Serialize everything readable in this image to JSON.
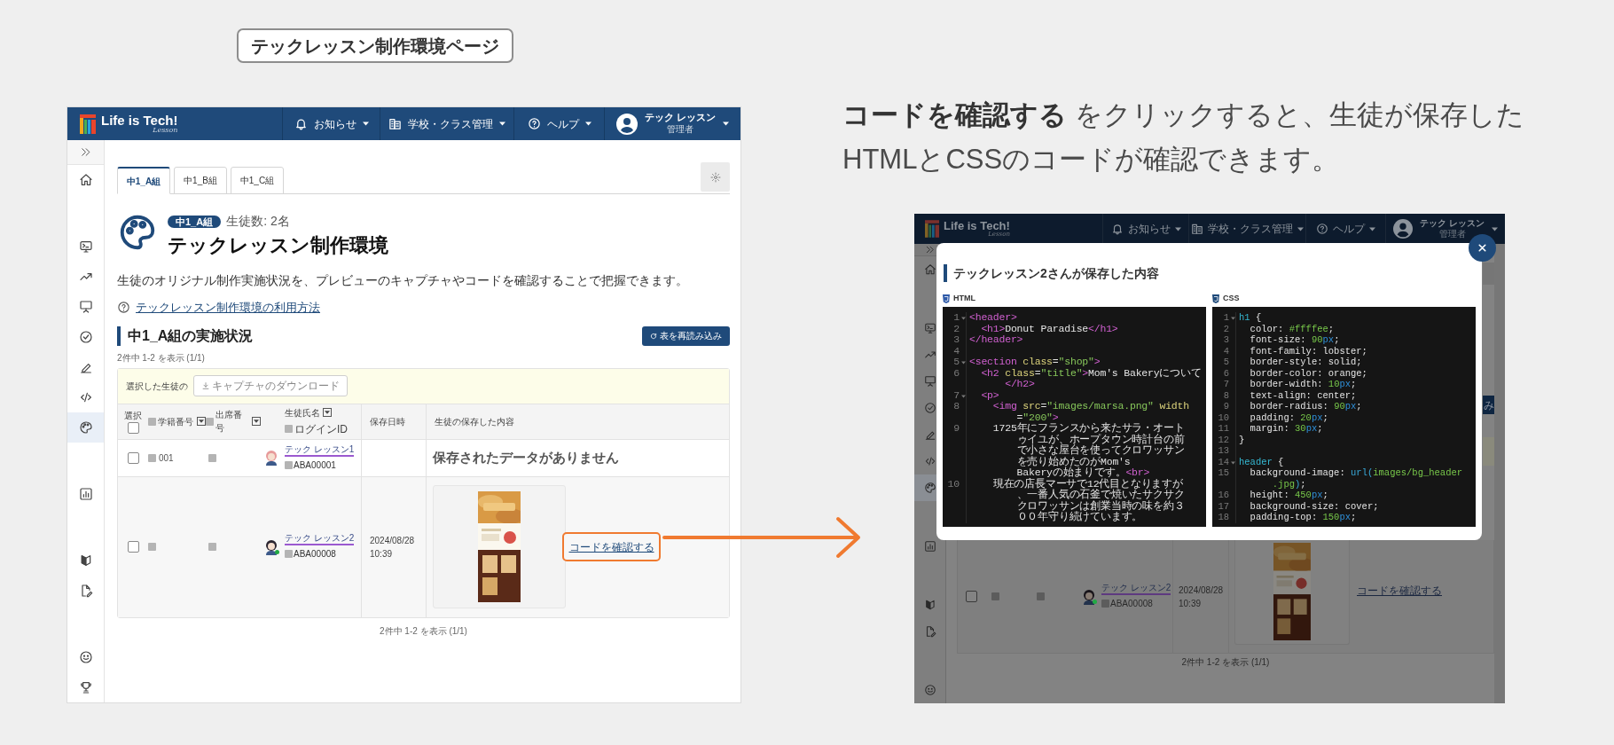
{
  "page_heading": "テックレッスン制作環境ページ",
  "caption": [
    "**コードを確認する** をクリックすると、生徒が保存した",
    "HTMLとCSSのコードが確認できます。"
  ],
  "main_screen": {
    "navbar": {
      "logo": "Life is Tech!",
      "logo_sub": "Lesson",
      "menus": [
        {
          "kind": "bell",
          "label": "お知らせ"
        },
        {
          "kind": "building",
          "label": "学校・クラス管理"
        },
        {
          "kind": "help",
          "label": "ヘルプ"
        }
      ],
      "user": {
        "name": "テック レッスン",
        "role": "管理者"
      }
    },
    "sidebar": {
      "groups": [
        [
          {
            "kind": "home",
            "selected": false
          }
        ],
        [
          {
            "kind": "terminal",
            "selected": false
          },
          {
            "kind": "trend",
            "selected": false
          },
          {
            "kind": "presentation",
            "selected": false
          },
          {
            "kind": "check",
            "selected": false
          },
          {
            "kind": "pencil",
            "selected": false
          },
          {
            "kind": "code",
            "selected": false
          },
          {
            "kind": "palette",
            "selected": true
          }
        ],
        [
          {
            "kind": "chart",
            "selected": false
          }
        ],
        [
          {
            "kind": "book",
            "selected": false
          },
          {
            "kind": "doc",
            "selected": false
          }
        ],
        [
          {
            "kind": "smile",
            "selected": false
          },
          {
            "kind": "trophy",
            "selected": false
          }
        ]
      ]
    },
    "tabs": [
      {
        "label": "中1_A組",
        "selected": true
      },
      {
        "label": "中1_B組",
        "selected": false
      },
      {
        "label": "中1_C組",
        "selected": false
      }
    ],
    "class_badge": "中1_A組",
    "student_count": "生徒数: 2名",
    "title": "テックレッスン制作環境",
    "description": "生徒のオリジナル制作実施状況を、プレビューのキャプチャやコードを確認することで把握できます。",
    "help_link": "テックレッスン制作環境の利用方法",
    "section_title": "中1_A組の実施状況",
    "reload_button": "表を再読み込み",
    "count_top": "2件中 1-2 を表示 (1/1)",
    "bulk_bar": {
      "label": "選択した生徒の",
      "button": "キャプチャのダウンロード",
      "disabled": true
    },
    "table": {
      "columns": [
        {
          "label": "選択",
          "kind": "select",
          "checked": false
        },
        {
          "label": "学籍番号",
          "kind": "sort"
        },
        {
          "label": "出席番号",
          "kind": "sort"
        },
        {
          "label": "生徒氏名",
          "sub": "ログインID",
          "kind": "name"
        },
        {
          "label": "保存日時",
          "kind": "plain"
        },
        {
          "label": "生徒の保存した内容",
          "kind": "plain"
        }
      ],
      "rows": [
        {
          "kind": "empty",
          "checked": false,
          "student_no": "001",
          "name": "テック レッスン1",
          "login_id": "ABA00001",
          "online": false,
          "message": "保存されたデータがありません"
        },
        {
          "kind": "saved",
          "checked": false,
          "name": "テック レッスン2",
          "login_id": "ABA00008",
          "online": true,
          "saved_date": "2024/08/28",
          "saved_time": "10:39",
          "code_link": "コードを確認する",
          "highlighted": true
        }
      ]
    },
    "count_bottom": "2件中 1-2 を表示 (1/1)"
  },
  "preview_screen": {
    "navbar": {
      "logo": "Life is Tech!",
      "logo_sub": "Lesson",
      "menus": [
        {
          "kind": "bell",
          "label": "お知らせ"
        },
        {
          "kind": "building",
          "label": "学校・クラス管理"
        },
        {
          "kind": "help",
          "label": "ヘルプ"
        }
      ],
      "user": {
        "name": "テック レッスン",
        "role": "管理者"
      }
    },
    "sidebar": {
      "groups": [
        [
          {
            "kind": "home",
            "selected": false
          }
        ],
        [
          {
            "kind": "terminal",
            "selected": false
          },
          {
            "kind": "trend",
            "selected": false
          },
          {
            "kind": "presentation",
            "selected": false
          },
          {
            "kind": "check",
            "selected": false
          },
          {
            "kind": "pencil",
            "selected": false
          },
          {
            "kind": "code",
            "selected": false
          },
          {
            "kind": "palette",
            "selected": true
          }
        ],
        [
          {
            "kind": "chart",
            "selected": false
          }
        ],
        [
          {
            "kind": "book",
            "selected": false
          },
          {
            "kind": "doc",
            "selected": false
          }
        ],
        [
          {
            "kind": "smile",
            "selected": false
          }
        ]
      ]
    },
    "reload_fragment": "み",
    "row": {
      "checked": false,
      "name": "テック レッスン2",
      "login_id": "ABA00008",
      "online": true,
      "saved_date": "2024/08/28",
      "saved_time": "10:39",
      "code_link": "コードを確認する"
    },
    "count_bottom": "2件中 1-2 を表示 (1/1)",
    "modal": {
      "title": "テックレッスン2さんが保存した内容",
      "panels": [
        {
          "label": "HTML",
          "kind": "html",
          "lines": [
            {
              "number": "1",
              "fold": true,
              "tokens": [
                {
                  "kind": "tag",
                  "text": "<header>"
                }
              ]
            },
            {
              "number": "2",
              "fold": false,
              "tokens": [
                {
                  "kind": "tag",
                  "text": "  <h1>"
                },
                {
                  "kind": "text",
                  "text": "Donut Paradise"
                },
                {
                  "kind": "tag",
                  "text": "</h1>"
                }
              ]
            },
            {
              "number": "3",
              "fold": false,
              "tokens": [
                {
                  "kind": "tag",
                  "text": "</header>"
                }
              ]
            },
            {
              "number": "4",
              "fold": false
            },
            {
              "number": "5",
              "fold": true,
              "tokens": [
                {
                  "kind": "tag",
                  "text": "<section"
                },
                {
                  "kind": "attr",
                  "text": " class"
                },
                {
                  "kind": "text",
                  "text": "="
                },
                {
                  "kind": "str",
                  "text": "\"shop\""
                },
                {
                  "kind": "tag",
                  "text": ">"
                }
              ]
            },
            {
              "number": "6",
              "fold": false,
              "tokens": [
                {
                  "kind": "tag",
                  "text": "  <h2"
                },
                {
                  "kind": "attr",
                  "text": " class"
                },
                {
                  "kind": "text",
                  "text": "="
                },
                {
                  "kind": "str",
                  "text": "\"title\""
                },
                {
                  "kind": "tag",
                  "text": ">"
                },
                {
                  "kind": "text",
                  "text": "Mom's Bakeryについて"
                }
              ]
            },
            {
              "tokens": [
                {
                  "kind": "tag",
                  "text": "      </h2>"
                }
              ]
            },
            {
              "number": "7",
              "fold": true,
              "tokens": [
                {
                  "kind": "tag",
                  "text": "  <p>"
                }
              ]
            },
            {
              "number": "8",
              "fold": false,
              "tokens": [
                {
                  "kind": "tag",
                  "text": "    <img"
                },
                {
                  "kind": "attr",
                  "text": " src"
                },
                {
                  "kind": "text",
                  "text": "="
                },
                {
                  "kind": "str",
                  "text": "\"images/marsa.png\""
                },
                {
                  "kind": "attr",
                  "text": " width"
                }
              ]
            },
            {
              "tokens": [
                {
                  "kind": "text",
                  "text": "        ="
                },
                {
                  "kind": "str",
                  "text": "\"200\""
                },
                {
                  "kind": "tag",
                  "text": ">"
                }
              ]
            },
            {
              "number": "9",
              "fold": false,
              "tokens": [
                {
                  "kind": "text",
                  "text": "    1725年にフランスから来たサラ・オート"
                }
              ]
            },
            {
              "tokens": [
                {
                  "kind": "text",
                  "text": "        ゥイユが、ホープタウン時計台の前"
                }
              ]
            },
            {
              "tokens": [
                {
                  "kind": "text",
                  "text": "        で小さな屋台を使ってクロワッサン"
                }
              ]
            },
            {
              "tokens": [
                {
                  "kind": "text",
                  "text": "        を売り始めたのがMom's"
                }
              ]
            },
            {
              "tokens": [
                {
                  "kind": "text",
                  "text": "        Bakeryの始まりです。"
                },
                {
                  "kind": "tag",
                  "text": "<br>"
                }
              ]
            },
            {
              "number": "10",
              "fold": false,
              "tokens": [
                {
                  "kind": "text",
                  "text": "    現在の店長マーサで12代目となりますが"
                }
              ]
            },
            {
              "tokens": [
                {
                  "kind": "text",
                  "text": "        、一番人気の石釜で焼いたサクサク"
                }
              ]
            },
            {
              "tokens": [
                {
                  "kind": "text",
                  "text": "        クロワッサンは創業当時の味を約３"
                }
              ]
            },
            {
              "tokens": [
                {
                  "kind": "text",
                  "text": "        ００年守り続けています。"
                }
              ]
            }
          ]
        },
        {
          "label": "CSS",
          "kind": "css",
          "lines": [
            {
              "number": "1",
              "fold": true,
              "tokens": [
                {
                  "kind": "sel",
                  "text": "h1"
                },
                {
                  "kind": "text",
                  "text": " {"
                }
              ]
            },
            {
              "number": "2",
              "fold": false,
              "tokens": [
                {
                  "kind": "text",
                  "text": "  color: "
                },
                {
                  "kind": "num",
                  "text": "#ffffee"
                },
                {
                  "kind": "text",
                  "text": ";"
                }
              ]
            },
            {
              "number": "3",
              "fold": false,
              "tokens": [
                {
                  "kind": "text",
                  "text": "  font-size: "
                },
                {
                  "kind": "num",
                  "text": "90"
                },
                {
                  "kind": "unit",
                  "text": "px"
                },
                {
                  "kind": "text",
                  "text": ";"
                }
              ]
            },
            {
              "number": "4",
              "fold": false,
              "tokens": [
                {
                  "kind": "text",
                  "text": "  font-family: lobster;"
                }
              ]
            },
            {
              "number": "5",
              "fold": false,
              "tokens": [
                {
                  "kind": "text",
                  "text": "  border-style: solid;"
                }
              ]
            },
            {
              "number": "6",
              "fold": false,
              "tokens": [
                {
                  "kind": "text",
                  "text": "  border-color: orange;"
                }
              ]
            },
            {
              "number": "7",
              "fold": false,
              "tokens": [
                {
                  "kind": "text",
                  "text": "  border-width: "
                },
                {
                  "kind": "num",
                  "text": "10"
                },
                {
                  "kind": "unit",
                  "text": "px"
                },
                {
                  "kind": "text",
                  "text": ";"
                }
              ]
            },
            {
              "number": "8",
              "fold": false,
              "tokens": [
                {
                  "kind": "text",
                  "text": "  text-align: center;"
                }
              ]
            },
            {
              "number": "9",
              "fold": false,
              "tokens": [
                {
                  "kind": "text",
                  "text": "  border-radius: "
                },
                {
                  "kind": "num",
                  "text": "90"
                },
                {
                  "kind": "unit",
                  "text": "px"
                },
                {
                  "kind": "text",
                  "text": ";"
                }
              ]
            },
            {
              "number": "10",
              "fold": false,
              "tokens": [
                {
                  "kind": "text",
                  "text": "  padding: "
                },
                {
                  "kind": "num",
                  "text": "20"
                },
                {
                  "kind": "unit",
                  "text": "px"
                },
                {
                  "kind": "text",
                  "text": ";"
                }
              ]
            },
            {
              "number": "11",
              "fold": false,
              "tokens": [
                {
                  "kind": "text",
                  "text": "  margin: "
                },
                {
                  "kind": "num",
                  "text": "30"
                },
                {
                  "kind": "unit",
                  "text": "px"
                },
                {
                  "kind": "text",
                  "text": ";"
                }
              ]
            },
            {
              "number": "12",
              "fold": false,
              "tokens": [
                {
                  "kind": "text",
                  "text": "}"
                }
              ]
            },
            {
              "number": "13",
              "fold": false
            },
            {
              "number": "14",
              "fold": true,
              "tokens": [
                {
                  "kind": "sel",
                  "text": "header"
                },
                {
                  "kind": "text",
                  "text": " {"
                }
              ]
            },
            {
              "number": "15",
              "fold": false,
              "tokens": [
                {
                  "kind": "text",
                  "text": "  background-image: "
                },
                {
                  "kind": "url",
                  "text": "url("
                },
                {
                  "kind": "num",
                  "text": "images/bg_header"
                }
              ]
            },
            {
              "tokens": [
                {
                  "kind": "num",
                  "text": "      .jpg"
                },
                {
                  "kind": "url",
                  "text": ")"
                },
                {
                  "kind": "text",
                  "text": ";"
                }
              ]
            },
            {
              "number": "16",
              "fold": false,
              "tokens": [
                {
                  "kind": "text",
                  "text": "  height: "
                },
                {
                  "kind": "num",
                  "text": "450"
                },
                {
                  "kind": "unit",
                  "text": "px"
                },
                {
                  "kind": "text",
                  "text": ";"
                }
              ]
            },
            {
              "number": "17",
              "fold": false,
              "tokens": [
                {
                  "kind": "text",
                  "text": "  background-size: cover;"
                }
              ]
            },
            {
              "number": "18",
              "fold": false,
              "tokens": [
                {
                  "kind": "text",
                  "text": "  padding-top: "
                },
                {
                  "kind": "num",
                  "text": "150"
                },
                {
                  "kind": "unit",
                  "text": "px"
                },
                {
                  "kind": "text",
                  "text": ";"
                }
              ]
            }
          ]
        }
      ]
    }
  }
}
